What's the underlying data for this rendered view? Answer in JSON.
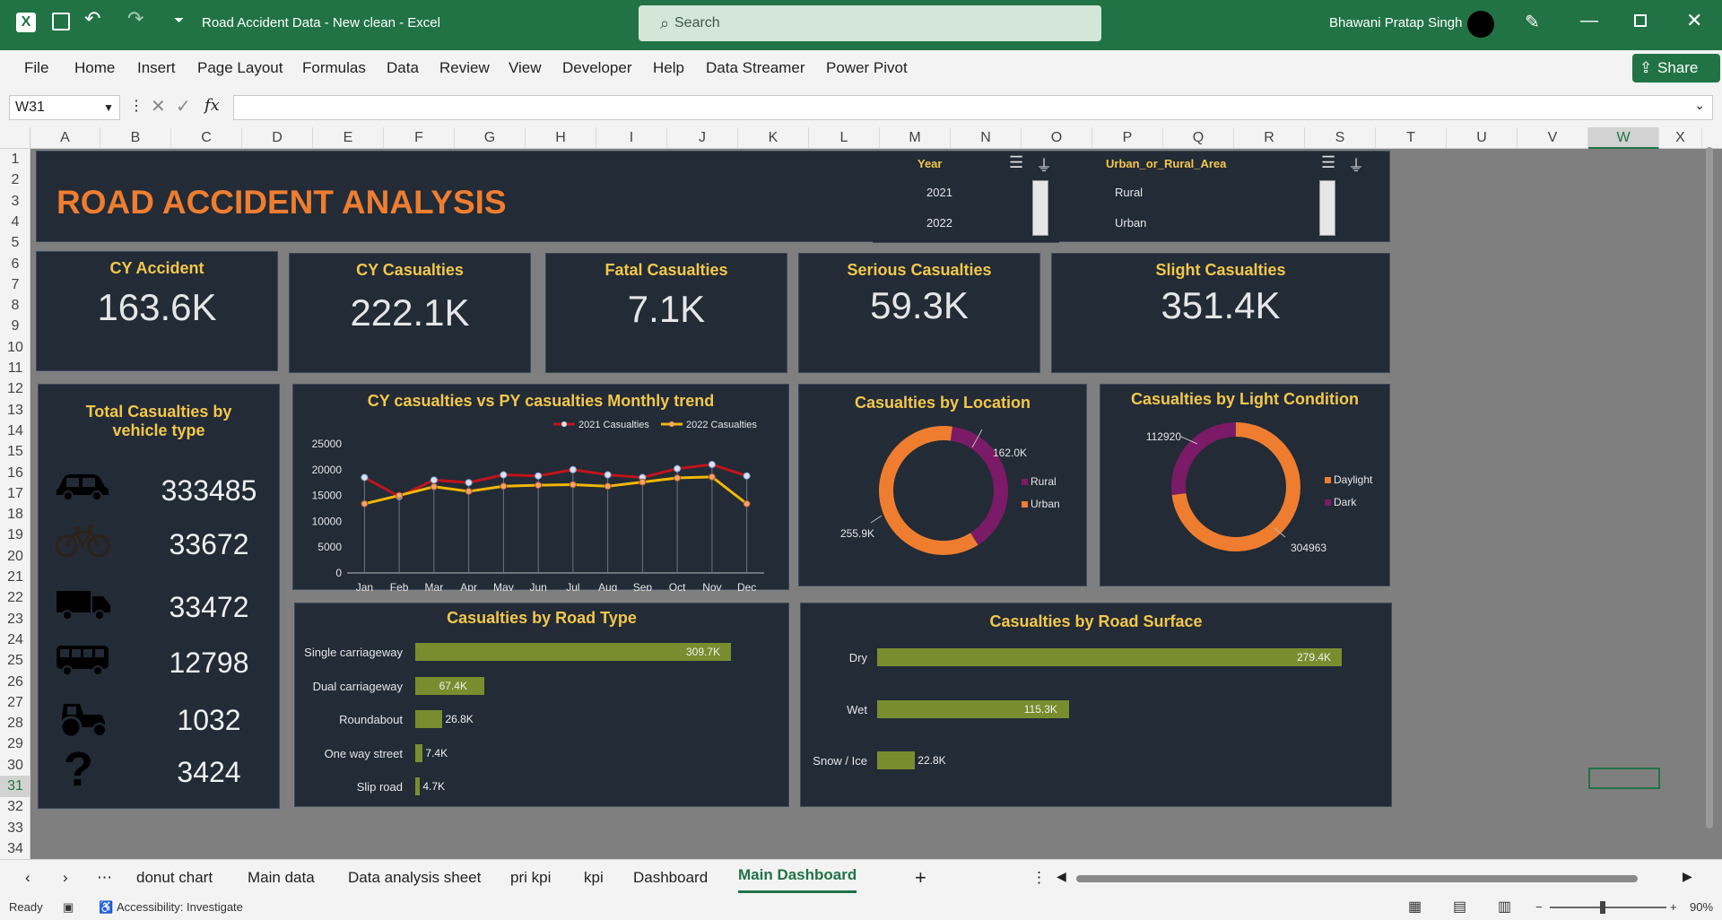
{
  "titlebar": {
    "doc_title": "Road Accident Data - New clean  -  Excel",
    "search_placeholder": "Search",
    "user_name": "Bhawani Pratap Singh"
  },
  "ribbon": {
    "tabs": [
      "File",
      "Home",
      "Insert",
      "Page Layout",
      "Formulas",
      "Data",
      "Review",
      "View",
      "Developer",
      "Help",
      "Data Streamer",
      "Power Pivot"
    ],
    "share_label": "Share"
  },
  "formula_bar": {
    "name_box": "W31",
    "fx": "fx",
    "content": ""
  },
  "columns": [
    "A",
    "B",
    "C",
    "D",
    "E",
    "F",
    "G",
    "H",
    "I",
    "J",
    "K",
    "L",
    "M",
    "N",
    "O",
    "P",
    "Q",
    "R",
    "S",
    "T",
    "U",
    "V",
    "W",
    "X"
  ],
  "rows": [
    "1",
    "2",
    "3",
    "4",
    "5",
    "6",
    "7",
    "8",
    "9",
    "10",
    "11",
    "12",
    "13",
    "14",
    "15",
    "16",
    "17",
    "18",
    "19",
    "20",
    "21",
    "22",
    "23",
    "24",
    "25",
    "26",
    "27",
    "28",
    "29",
    "30",
    "31",
    "32",
    "33",
    "34"
  ],
  "dashboard": {
    "title": "ROAD ACCIDENT ANALYSIS",
    "slicer_year": {
      "header": "Year",
      "items": [
        "2021",
        "2022"
      ]
    },
    "slicer_area": {
      "header": "Urban_or_Rural_Area",
      "items": [
        "Rural",
        "Urban"
      ]
    },
    "kpis": [
      {
        "title": "CY Accident",
        "value": "163.6K"
      },
      {
        "title": "CY Casualties",
        "value": "222.1K"
      },
      {
        "title": "Fatal Casualties",
        "value": "7.1K"
      },
      {
        "title": "Serious Casualties",
        "value": "59.3K"
      },
      {
        "title": "Slight Casualties",
        "value": "351.4K"
      }
    ],
    "vehicle": {
      "title": "Total Casualties by vehicle type",
      "items": [
        {
          "icon": "car-icon",
          "value": "333485"
        },
        {
          "icon": "bicycle-icon",
          "value": "33672"
        },
        {
          "icon": "truck-icon",
          "value": "33472"
        },
        {
          "icon": "bus-icon",
          "value": "12798"
        },
        {
          "icon": "tractor-icon",
          "value": "1032"
        },
        {
          "icon": "question-icon",
          "value": "3424"
        }
      ]
    }
  },
  "chart_data": [
    {
      "type": "line",
      "title": "CY casualties vs PY casualties Monthly trend",
      "categories": [
        "Jan",
        "Feb",
        "Mar",
        "Apr",
        "May",
        "Jun",
        "Jul",
        "Aug",
        "Sep",
        "Oct",
        "Nov",
        "Dec"
      ],
      "series": [
        {
          "name": "2021 Casualties",
          "color": "#c0141b",
          "values": [
            18500,
            14800,
            18000,
            17500,
            19000,
            18800,
            20000,
            19000,
            18500,
            20200,
            21000,
            18800
          ]
        },
        {
          "name": "2022 Casualties",
          "color": "#f2b705",
          "values": [
            13400,
            15000,
            16700,
            15800,
            16800,
            17000,
            17100,
            16800,
            17600,
            18400,
            18600,
            13400
          ]
        }
      ],
      "y_ticks": [
        0,
        5000,
        10000,
        15000,
        20000,
        25000
      ],
      "ylim": [
        0,
        25000
      ],
      "legend": "top-right"
    },
    {
      "type": "pie",
      "title": "Casualties by Location",
      "labels": [
        "Rural",
        "Urban"
      ],
      "values": [
        162.0,
        255.9
      ],
      "value_labels": [
        "162.0K",
        "255.9K"
      ],
      "colors": [
        "#7b1a66",
        "#ef7d2f"
      ],
      "legend": "right"
    },
    {
      "type": "pie",
      "title": "Casualties by Light Condition",
      "labels": [
        "Daylight",
        "Dark"
      ],
      "values": [
        304963,
        112920
      ],
      "value_labels": [
        "304963",
        "112920"
      ],
      "colors": [
        "#ef7d2f",
        "#7b1a66"
      ],
      "legend": "right"
    },
    {
      "type": "bar",
      "title": "Casualties by Road Type",
      "categories": [
        "Single carriageway",
        "Dual carriageway",
        "Roundabout",
        "One way street",
        "Slip road"
      ],
      "values": [
        309.7,
        67.4,
        26.8,
        7.4,
        4.7
      ],
      "value_labels": [
        "309.7K",
        "67.4K",
        "26.8K",
        "7.4K",
        "4.7K"
      ],
      "color": "#7a8d2e"
    },
    {
      "type": "bar",
      "title": "Casualties by Road Surface",
      "categories": [
        "Dry",
        "Wet",
        "Snow / Ice"
      ],
      "values": [
        279.4,
        115.3,
        22.8
      ],
      "value_labels": [
        "279.4K",
        "115.3K",
        "22.8K"
      ],
      "color": "#7a8d2e"
    }
  ],
  "sheet_tabs": [
    "donut chart",
    "Main data",
    "Data analysis sheet",
    "pri kpi",
    "kpi",
    "Dashboard",
    "Main Dashboard"
  ],
  "active_tab": "Main Dashboard",
  "status": {
    "ready": "Ready",
    "accessibility": "Accessibility: Investigate",
    "zoom": "90%"
  }
}
